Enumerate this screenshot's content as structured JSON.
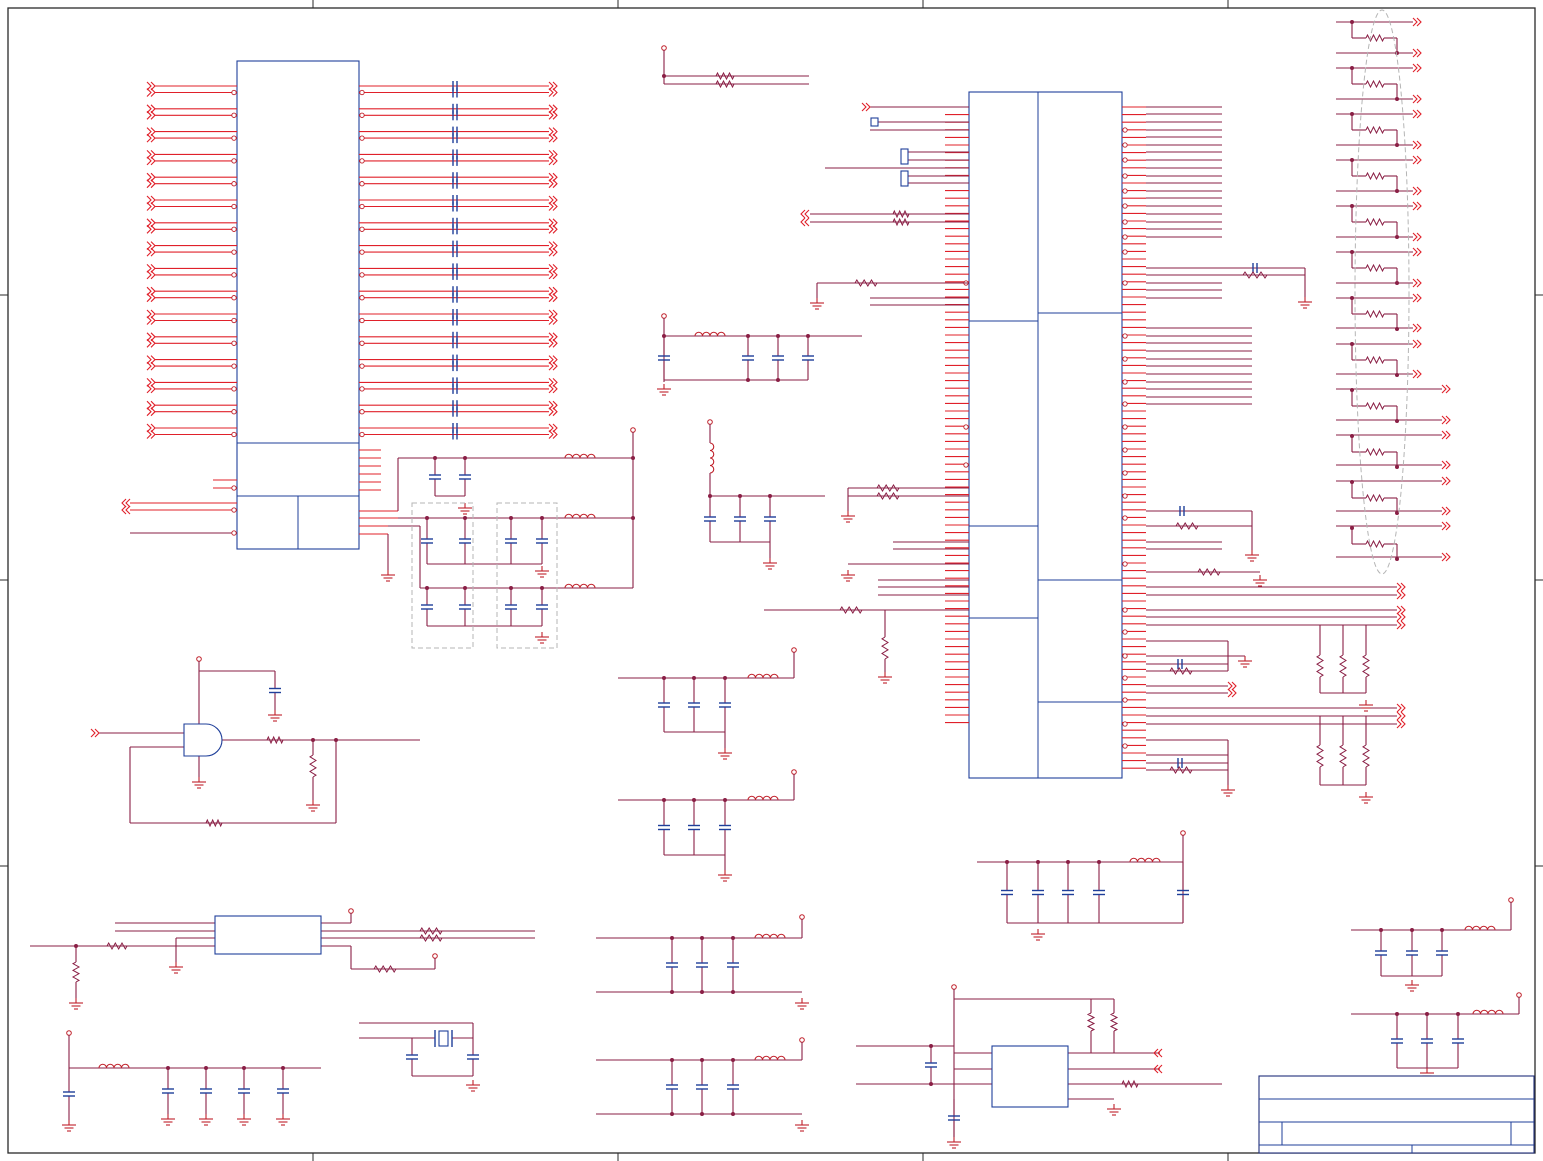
{
  "sheet": {
    "background": "#ffffff",
    "border_color": "#2a2a2a",
    "wire_color": "#8a1f45",
    "pin_color": "#e0202a",
    "component_color": "#1f3f9a",
    "text_labels": []
  }
}
